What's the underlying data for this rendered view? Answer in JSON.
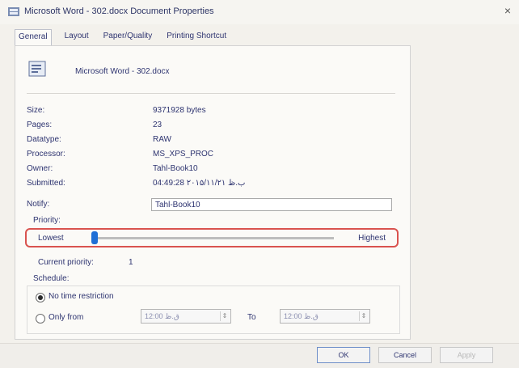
{
  "window": {
    "title": "Microsoft Word - 302.docx Document Properties",
    "close_glyph": "×"
  },
  "tabs": [
    {
      "label": "General"
    },
    {
      "label": "Layout"
    },
    {
      "label": "Paper/Quality"
    },
    {
      "label": "Printing Shortcut"
    }
  ],
  "document": {
    "name": "Microsoft Word - 302.docx"
  },
  "properties": [
    {
      "label": "Size:",
      "value": "9371928 bytes"
    },
    {
      "label": "Pages:",
      "value": "23"
    },
    {
      "label": "Datatype:",
      "value": "RAW"
    },
    {
      "label": "Processor:",
      "value": "MS_XPS_PROC"
    },
    {
      "label": "Owner:",
      "value": "Tahl-Book10"
    },
    {
      "label": "Submitted:",
      "value": "04:49:28 ۲۰۱۵/۱۱/۲۱ ب.ظ"
    }
  ],
  "notify": {
    "label": "Notify:",
    "value": "Tahl-Book10"
  },
  "priority": {
    "group_label": "Priority:",
    "lowest_label": "Lowest",
    "highest_label": "Highest",
    "level_fraction": 0.0,
    "current_label": "Current priority:",
    "current_value": "1"
  },
  "schedule": {
    "group_label": "Schedule:",
    "no_restriction_label": "No time restriction",
    "only_from_label": "Only from",
    "from_time": "12:00 ق.ظ",
    "to_label": "To",
    "to_time": "12:00 ق.ظ"
  },
  "buttons": {
    "ok": "OK",
    "cancel": "Cancel",
    "apply": "Apply"
  },
  "colors": {
    "highlight_border": "#d9534f",
    "slider_thumb": "#1f6fd6"
  },
  "icons": {
    "title": "printer-icon",
    "document": "document-icon",
    "spin": "spin-arrows-icon"
  }
}
